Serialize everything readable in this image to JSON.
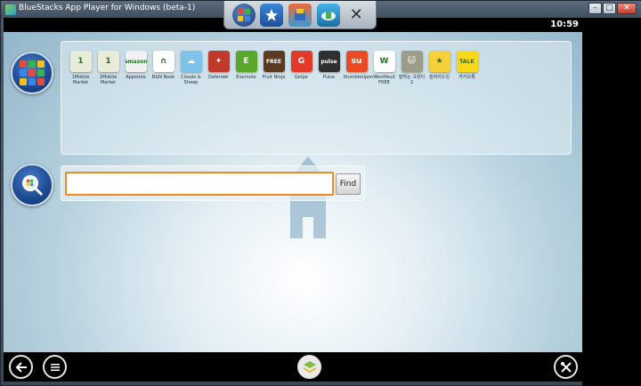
{
  "window": {
    "title": "BlueStacks App Player for Windows (beta-1)",
    "controls": [
      "–",
      "□",
      "✕"
    ]
  },
  "dock": {
    "icons": [
      "apps-grid-icon",
      "star-icon",
      "app-store-icon",
      "cloud-sync-icon",
      "close-icon"
    ],
    "close_glyph": "✕"
  },
  "status": {
    "time": "10:59"
  },
  "apps": [
    {
      "label": "1Mobile Market",
      "glyph": "1",
      "color": "#e8ecd9"
    },
    {
      "label": "1Mobile Market",
      "glyph": "1",
      "color": "#e8ecd9"
    },
    {
      "label": "Appstore",
      "glyph": "amazon",
      "color": "#f1f1f1"
    },
    {
      "label": "B&N Nook",
      "glyph": "∩",
      "color": "#ffffff"
    },
    {
      "label": "Clouds & Sheep",
      "glyph": "☁",
      "color": "#7fc3e8"
    },
    {
      "label": "Defender",
      "glyph": "✦",
      "color": "#c0392b"
    },
    {
      "label": "Evernote",
      "glyph": "E",
      "color": "#5aa82a"
    },
    {
      "label": "Fruit Ninja",
      "glyph": "FREE",
      "color": "#5b3a21"
    },
    {
      "label": "Getjar",
      "glyph": "G",
      "color": "#e23a2a"
    },
    {
      "label": "Pulse",
      "glyph": "pulse",
      "color": "#2f2f2f"
    },
    {
      "label": "StumbleUpon",
      "glyph": "su",
      "color": "#ea4b24"
    },
    {
      "label": "Wordfeud FREE",
      "glyph": "W",
      "color": "#ffffff"
    },
    {
      "label": "말하는 고양이 2",
      "glyph": "🐱",
      "color": "#9c9c8a"
    },
    {
      "label": "슬라이드잇",
      "glyph": "★",
      "color": "#f4d13a"
    },
    {
      "label": "카카오톡",
      "glyph": "TALK",
      "color": "#f8d81b"
    }
  ],
  "search": {
    "value": "",
    "placeholder": "",
    "find_label": "Find"
  },
  "colors": {
    "accent_orange": "#f08a1c",
    "side_blue": "#1e4d96"
  }
}
